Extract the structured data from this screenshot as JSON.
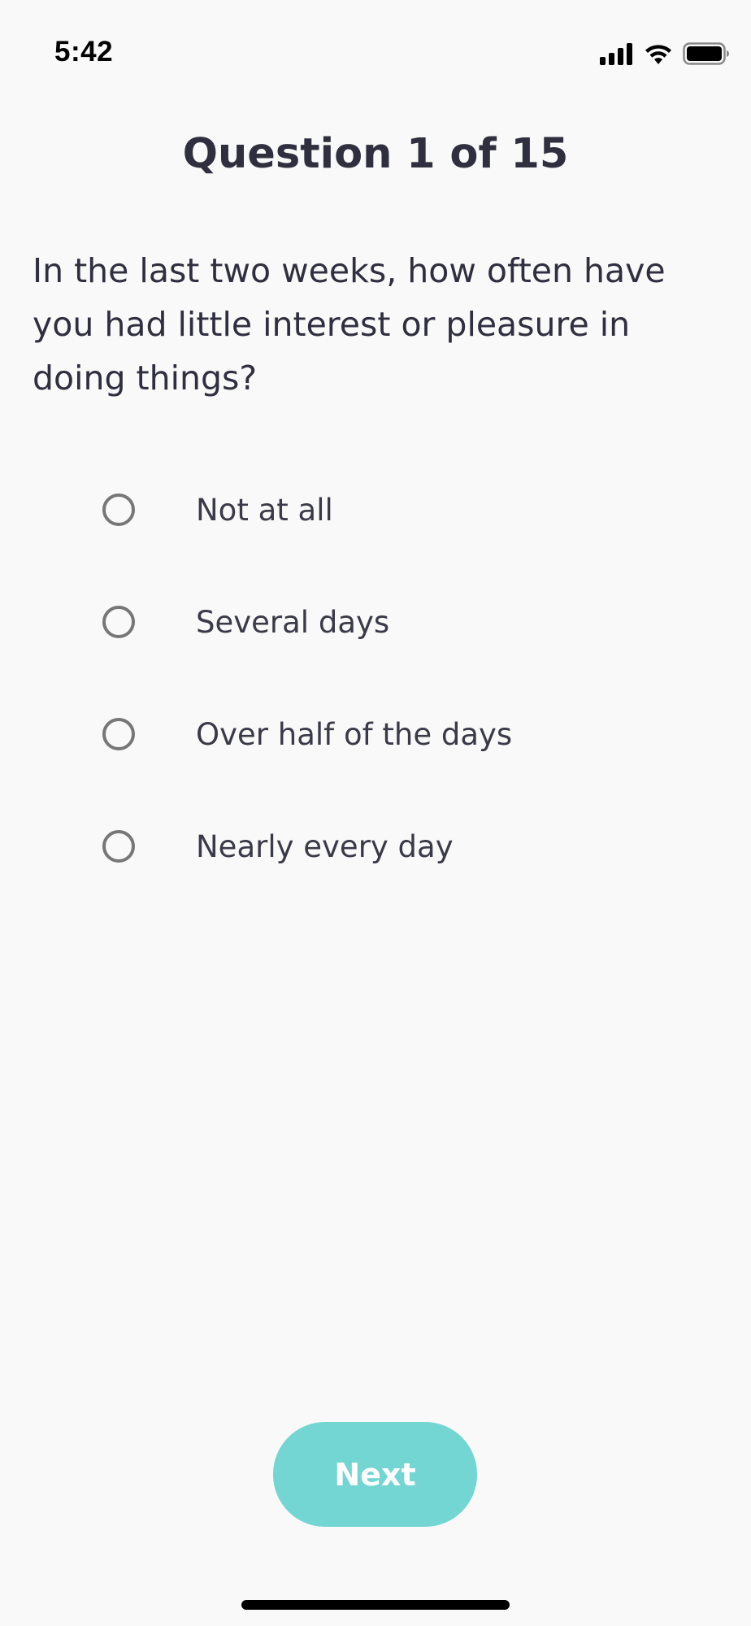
{
  "status_bar": {
    "time": "5:42",
    "icons": [
      "cellular-signal-icon",
      "wifi-icon",
      "battery-icon"
    ]
  },
  "header": {
    "title": "Question 1 of 15"
  },
  "question": {
    "text": "In the last two weeks, how often have you had little interest or pleasure in doing things?"
  },
  "options": [
    {
      "label": "Not at all",
      "selected": false
    },
    {
      "label": "Several days",
      "selected": false
    },
    {
      "label": "Over half of the days",
      "selected": false
    },
    {
      "label": "Nearly every day",
      "selected": false
    }
  ],
  "footer": {
    "next_label": "Next"
  },
  "colors": {
    "background": "#f9f9f9",
    "text": "#2f2f3f",
    "radio_border": "#777777",
    "accent_button": "#74d6d2",
    "button_text": "#ffffff"
  }
}
